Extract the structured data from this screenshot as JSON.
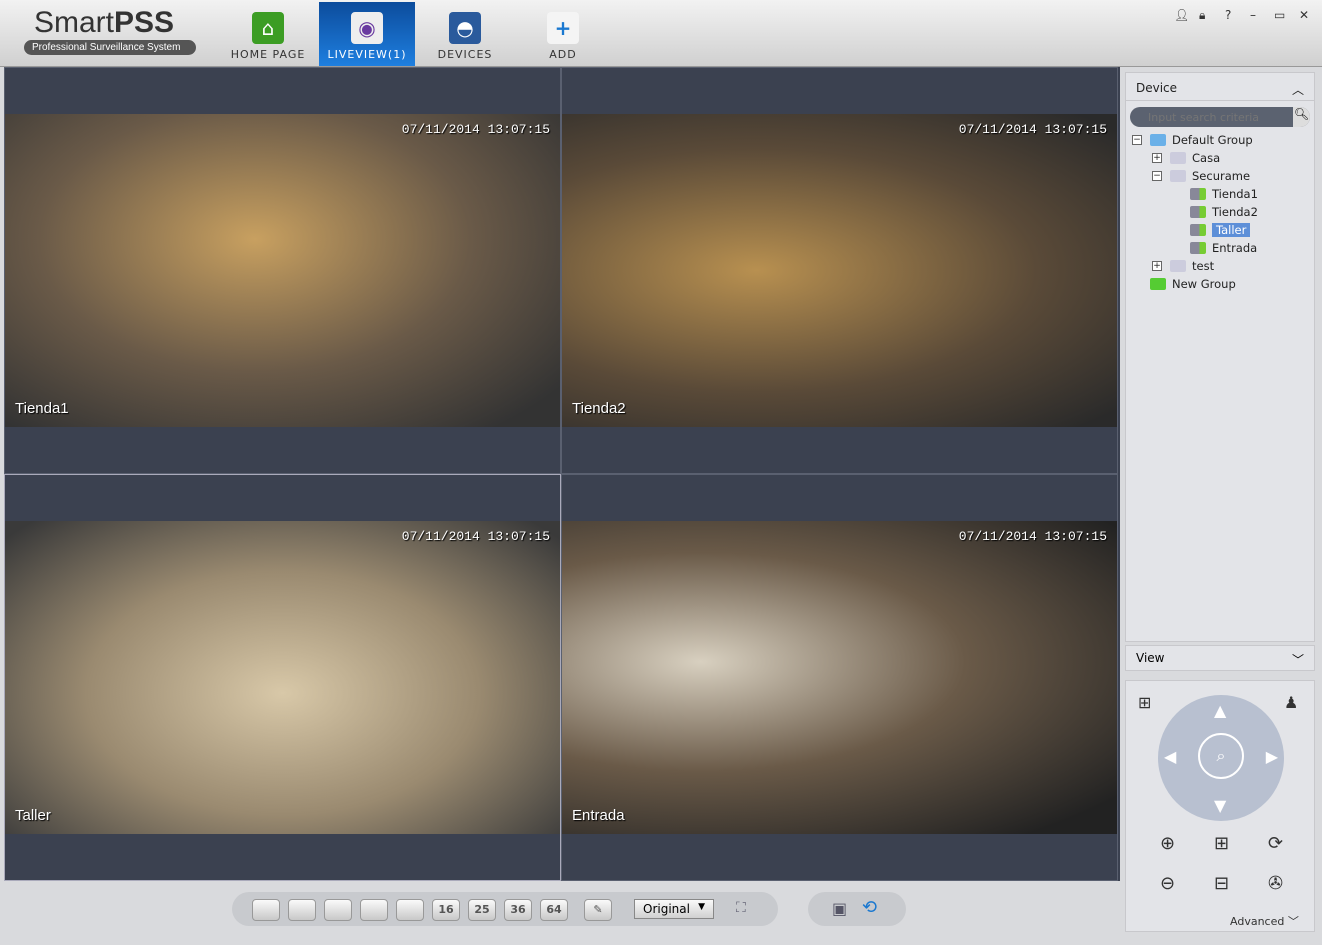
{
  "app": {
    "name_light": "Smart",
    "name_bold": "PSS",
    "tagline": "Professional Surveillance System"
  },
  "nav": [
    {
      "label": "HOME PAGE",
      "icon": "home-icon"
    },
    {
      "label": "LIVEVIEW(1)",
      "icon": "camera-icon",
      "active": true
    },
    {
      "label": "DEVICES",
      "icon": "dome-camera-icon"
    },
    {
      "label": "ADD",
      "icon": "plus-icon"
    }
  ],
  "window_controls": [
    "user-icon",
    "lock-icon",
    "help-icon",
    "minimize-icon",
    "maximize-icon",
    "close-icon"
  ],
  "tiles": [
    {
      "name": "Tienda1",
      "timestamp": "07/11/2014 13:07:15"
    },
    {
      "name": "Tienda2",
      "timestamp": "07/11/2014 13:07:15"
    },
    {
      "name": "Taller",
      "timestamp": "07/11/2014 13:07:15",
      "selected": true
    },
    {
      "name": "Entrada",
      "timestamp": "07/11/2014 13:07:15"
    }
  ],
  "device_panel": {
    "title": "Device",
    "search_placeholder": "Input search criteria",
    "tree": [
      {
        "label": "Default Group",
        "level": 0,
        "toggle": "−",
        "type": "folder"
      },
      {
        "label": "Casa",
        "level": 1,
        "toggle": "+",
        "type": "device"
      },
      {
        "label": "Securame",
        "level": 1,
        "toggle": "−",
        "type": "device"
      },
      {
        "label": "Tienda1",
        "level": 2,
        "type": "camera"
      },
      {
        "label": "Tienda2",
        "level": 2,
        "type": "camera"
      },
      {
        "label": "Taller",
        "level": 2,
        "type": "camera",
        "selected": true
      },
      {
        "label": "Entrada",
        "level": 2,
        "type": "camera"
      },
      {
        "label": "test",
        "level": 1,
        "toggle": "+",
        "type": "device"
      },
      {
        "label": "New Group",
        "level": 0,
        "type": "new-group"
      }
    ]
  },
  "view_panel": {
    "title": "View"
  },
  "ptz": {
    "advanced_label": "Advanced"
  },
  "toolbar": {
    "layouts": [
      "",
      "",
      "",
      "",
      "",
      "16",
      "25",
      "36",
      "64"
    ],
    "stream": "Original"
  },
  "colors": {
    "accent": "#1e7fe0",
    "video_bg": "#3b4150"
  }
}
